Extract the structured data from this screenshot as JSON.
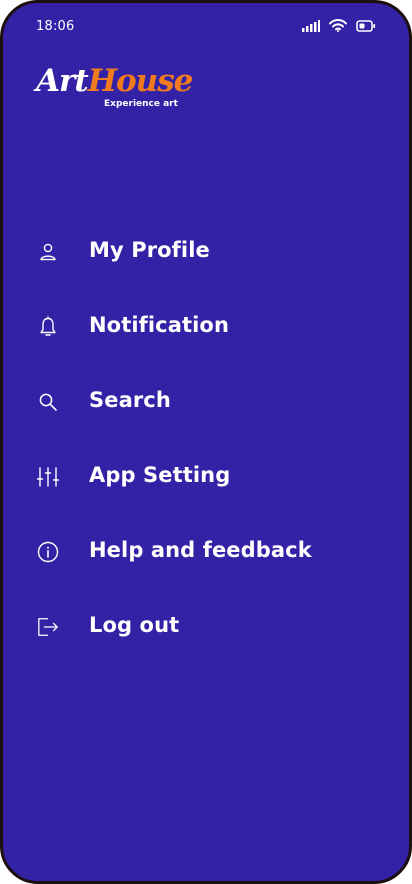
{
  "status_bar": {
    "time": "18:06",
    "icons": [
      "signal-icon",
      "wifi-icon",
      "battery-icon"
    ]
  },
  "logo": {
    "word_part1": "Art",
    "word_part2": "House",
    "tagline": "Experience art",
    "colors": {
      "primary": "#ffffff",
      "accent": "#f07a1e"
    }
  },
  "theme": {
    "background": "#3322a6",
    "frame": "#1d0f0e",
    "text": "#ffffff"
  },
  "menu": {
    "items": [
      {
        "label": "My Profile",
        "icon": "user-icon"
      },
      {
        "label": "Notification",
        "icon": "bell-icon"
      },
      {
        "label": "Search",
        "icon": "search-icon"
      },
      {
        "label": "App Setting",
        "icon": "sliders-icon"
      },
      {
        "label": "Help and feedback",
        "icon": "info-icon"
      },
      {
        "label": "Log out",
        "icon": "logout-icon"
      }
    ]
  }
}
